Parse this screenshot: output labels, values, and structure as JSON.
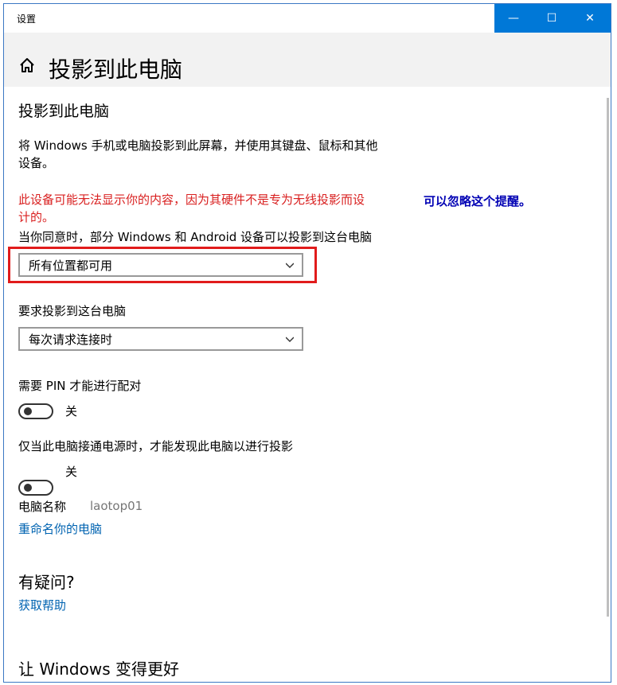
{
  "window": {
    "app_title": "设置",
    "page_title": "投影到此电脑"
  },
  "titlebar_buttons": {
    "minimize": "—",
    "maximize": "☐",
    "close": "✕"
  },
  "content": {
    "section_title": "投影到此电脑",
    "description_line1": "将 Windows 手机或电脑投影到此屏幕，并使用其键盘、鼠标和其他",
    "description_line2": "设备。",
    "warning_line1": "此设备可能无法显示你的内容，因为其硬件不是专为无线投影而设",
    "warning_line2": "计的。",
    "annotation_note": "可以忽略这个提醒。",
    "availability_label": "当你同意时，部分 Windows 和 Android 设备可以投影到这台电脑",
    "availability_value": "所有位置都可用",
    "request_label": "要求投影到这台电脑",
    "request_value": "每次请求连接时",
    "pin_label": "需要 PIN 才能进行配对",
    "pin_toggle_state": "关",
    "power_label": "仅当此电脑接通电源时，才能发现此电脑以进行投影",
    "power_toggle_state": "关",
    "pc_name_label": "电脑名称",
    "pc_name_value": "laotop01",
    "rename_link": "重命名你的电脑",
    "questions_title": "有疑问?",
    "help_link": "获取帮助",
    "improve_title": "让 Windows 变得更好"
  },
  "colors": {
    "accent": "#0078d7",
    "warning": "#d92020",
    "link": "#0063b1",
    "highlight": "#e11b1b",
    "note": "#0000b4"
  },
  "icons": {
    "home": "home-icon",
    "chevron": "chevron-down-icon"
  }
}
